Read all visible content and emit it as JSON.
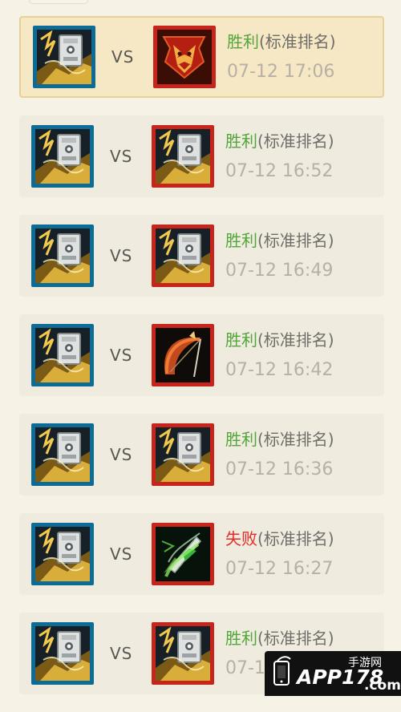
{
  "matches": [
    {
      "player_icon": "rune-icon",
      "vs": "VS",
      "opponent_icon": "war-banner-icon",
      "result": "胜利",
      "result_type": "win",
      "mode": "(标准排名)",
      "time": "07-12 17:06",
      "selected": true
    },
    {
      "player_icon": "rune-icon",
      "vs": "VS",
      "opponent_icon": "rune-icon",
      "result": "胜利",
      "result_type": "win",
      "mode": "(标准排名)",
      "time": "07-12 16:52",
      "selected": false
    },
    {
      "player_icon": "rune-icon",
      "vs": "VS",
      "opponent_icon": "rune-icon",
      "result": "胜利",
      "result_type": "win",
      "mode": "(标准排名)",
      "time": "07-12 16:49",
      "selected": false
    },
    {
      "player_icon": "rune-icon",
      "vs": "VS",
      "opponent_icon": "bow-icon",
      "result": "胜利",
      "result_type": "win",
      "mode": "(标准排名)",
      "time": "07-12 16:42",
      "selected": false
    },
    {
      "player_icon": "rune-icon",
      "vs": "VS",
      "opponent_icon": "rune-icon",
      "result": "胜利",
      "result_type": "win",
      "mode": "(标准排名)",
      "time": "07-12 16:36",
      "selected": false
    },
    {
      "player_icon": "rune-icon",
      "vs": "VS",
      "opponent_icon": "dagger-icon",
      "result": "失败",
      "result_type": "loss",
      "mode": "(标准排名)",
      "time": "07-12 16:27",
      "selected": false
    },
    {
      "player_icon": "rune-icon",
      "vs": "VS",
      "opponent_icon": "rune-icon",
      "result": "胜利",
      "result_type": "win",
      "mode": "(标准排名)",
      "time": "07-12 16:2",
      "selected": false
    }
  ],
  "colors": {
    "win": "#52a53a",
    "loss": "#e32b27",
    "player_border": "#0d6c95",
    "opponent_border": "#c7241c"
  },
  "watermark": {
    "text": "APP178",
    "sub": "手游网",
    "domain": ".com"
  }
}
